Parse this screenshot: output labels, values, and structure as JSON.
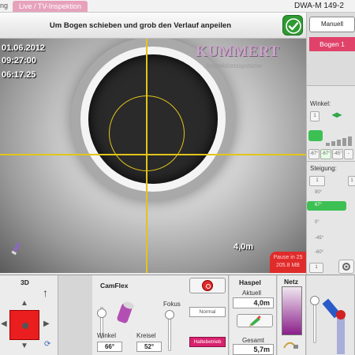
{
  "topbar": {
    "prev_tab": "ng",
    "active_tab": "Live / TV-Inspektion",
    "doc_id": "DWA-M 149-2"
  },
  "instruction": {
    "text": "Um Bogen schieben und grob den Verlauf anpeilen",
    "ok_icon": "checkmark-icon"
  },
  "video": {
    "date": "01.06.2012",
    "time": "09:27:00",
    "duration": "06:17.25",
    "brand": "KUMMERT",
    "brand_sub": "Inspektionssysteme",
    "distance": "4,0m",
    "paused_line1": "Pause in 25",
    "paused_line2": "205.8 MB",
    "overlay_color": "#e2c51a"
  },
  "right_panel": {
    "mode_button": "Manuell",
    "bogen_label": "Bogen 1",
    "winkel_label": "Winkel:",
    "winkel_btn": "1",
    "winkel_arrows": "↔",
    "winkel_options": [
      "-67°",
      "-67°",
      "-45°",
      "-"
    ],
    "steigung_label": "Steigung:",
    "steigung_scale": [
      "90°",
      "67°",
      "0°",
      "-45°",
      "-60°"
    ],
    "accent_green": "#3cc053",
    "accent_pink": "#e0426a"
  },
  "bottom": {
    "three_d": {
      "title": "3D",
      "compass": "↑"
    },
    "camflex": {
      "title": "CamFlex",
      "fokus_label": "Fokus",
      "winkel_label": "Winkel",
      "winkel_value": "66°",
      "kreisel_label": "Kreisel",
      "kreisel_value": "52°",
      "mode_button": "Normal",
      "halte_button": "Haltebetrieb"
    },
    "haspel": {
      "title": "Haspel",
      "aktuell_label": "Aktuell",
      "aktuell_value": "4,0m",
      "gesamt_label": "Gesamt",
      "gesamt_value": "5,7m"
    },
    "netz": {
      "title": "Netz"
    }
  }
}
